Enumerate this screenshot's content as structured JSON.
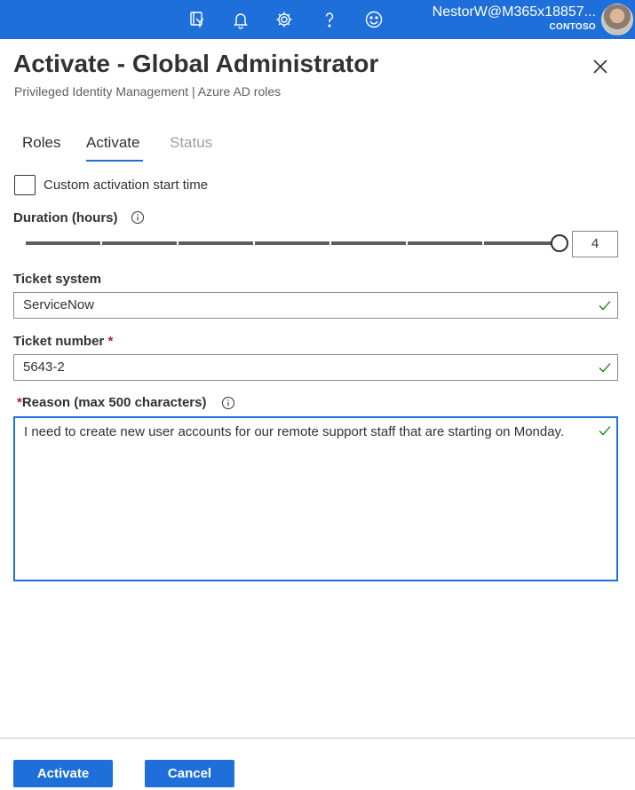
{
  "topbar": {
    "icons": [
      "directory-filter-icon",
      "bell-icon",
      "gear-icon",
      "help-icon",
      "smiley-icon"
    ],
    "account_name": "NestorW@M365x18857...",
    "tenant": "CONTOSO",
    "bar_color": "#1e6fd9"
  },
  "header": {
    "title": "Activate - Global Administrator",
    "subtitle": "Privileged Identity Management | Azure AD roles"
  },
  "tabs": [
    {
      "label": "Roles",
      "state": "normal"
    },
    {
      "label": "Activate",
      "state": "selected"
    },
    {
      "label": "Status",
      "state": "disabled"
    }
  ],
  "form": {
    "custom_start_label": "Custom activation start time",
    "custom_start_checked": false,
    "duration_label": "Duration (hours)",
    "duration_value": "4",
    "duration_slider_fraction": 1.0,
    "ticket_system_label": "Ticket system",
    "ticket_system_value": "ServiceNow",
    "ticket_number_label": "Ticket number",
    "ticket_number_required": "*",
    "ticket_number_value": "5643-2",
    "reason_required": "*",
    "reason_label": "Reason (max 500 characters)",
    "reason_value": "I need to create new user accounts for our remote support staff that are starting on Monday."
  },
  "footer": {
    "activate_label": "Activate",
    "cancel_label": "Cancel"
  },
  "colors": {
    "accent": "#1e6fd9",
    "valid": "#107c10",
    "required": "#a4262c"
  }
}
